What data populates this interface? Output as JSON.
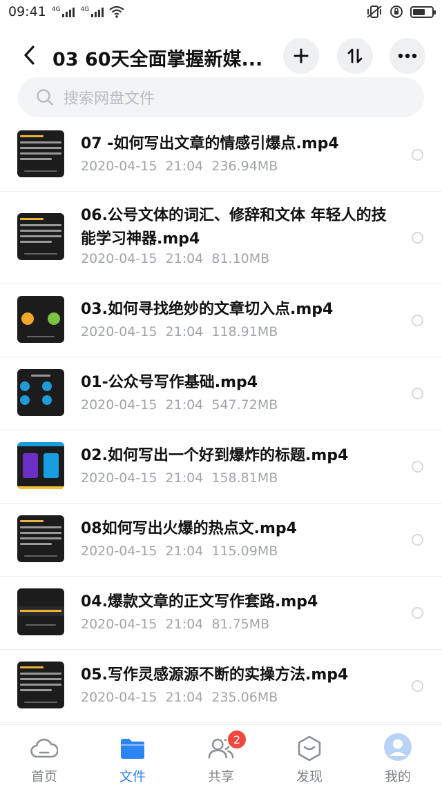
{
  "status_bar": {
    "time": "09:41",
    "signal1_label": "4G",
    "signal2_label": "4G"
  },
  "header": {
    "title": "03 60天全面掌握新媒..."
  },
  "search": {
    "placeholder": "搜索网盘文件"
  },
  "files": [
    {
      "name": "07 -如何写出文章的情感引爆点.mp4",
      "date": "2020-04-15",
      "time": "21:04",
      "size": "236.94MB",
      "thumb": "dark-text"
    },
    {
      "name": "06.公号文体的词汇、修辞和文体  年轻人的技能学习神器.mp4",
      "date": "2020-04-15",
      "time": "21:04",
      "size": "81.10MB",
      "thumb": "dark-text"
    },
    {
      "name": "03.如何寻找绝妙的文章切入点.mp4",
      "date": "2020-04-15",
      "time": "21:04",
      "size": "118.91MB",
      "thumb": "circles"
    },
    {
      "name": "01-公众号写作基础.mp4",
      "date": "2020-04-15",
      "time": "21:04",
      "size": "547.72MB",
      "thumb": "icons"
    },
    {
      "name": "02.如何写出一个好到爆炸的标题.mp4",
      "date": "2020-04-15",
      "time": "21:04",
      "size": "158.81MB",
      "thumb": "cards"
    },
    {
      "name": "08如何写出火爆的热点文.mp4",
      "date": "2020-04-15",
      "time": "21:04",
      "size": "115.09MB",
      "thumb": "dark-text"
    },
    {
      "name": "04.爆款文章的正文写作套路.mp4",
      "date": "2020-04-15",
      "time": "21:04",
      "size": "81.75MB",
      "thumb": "banner"
    },
    {
      "name": "05.写作灵感源源不断的实操方法.mp4",
      "date": "2020-04-15",
      "time": "21:04",
      "size": "235.06MB",
      "thumb": "dark-text"
    }
  ],
  "bottom_nav": [
    {
      "label": "首页",
      "icon": "cloud-icon"
    },
    {
      "label": "文件",
      "icon": "folder-icon",
      "active": true
    },
    {
      "label": "共享",
      "icon": "people-icon",
      "badge": "2"
    },
    {
      "label": "发现",
      "icon": "discover-icon"
    },
    {
      "label": "我的",
      "icon": "avatar-icon"
    }
  ],
  "colors": {
    "accent": "#2d82f4",
    "badge": "#f0483e",
    "meta_text": "#a0a4aa"
  }
}
